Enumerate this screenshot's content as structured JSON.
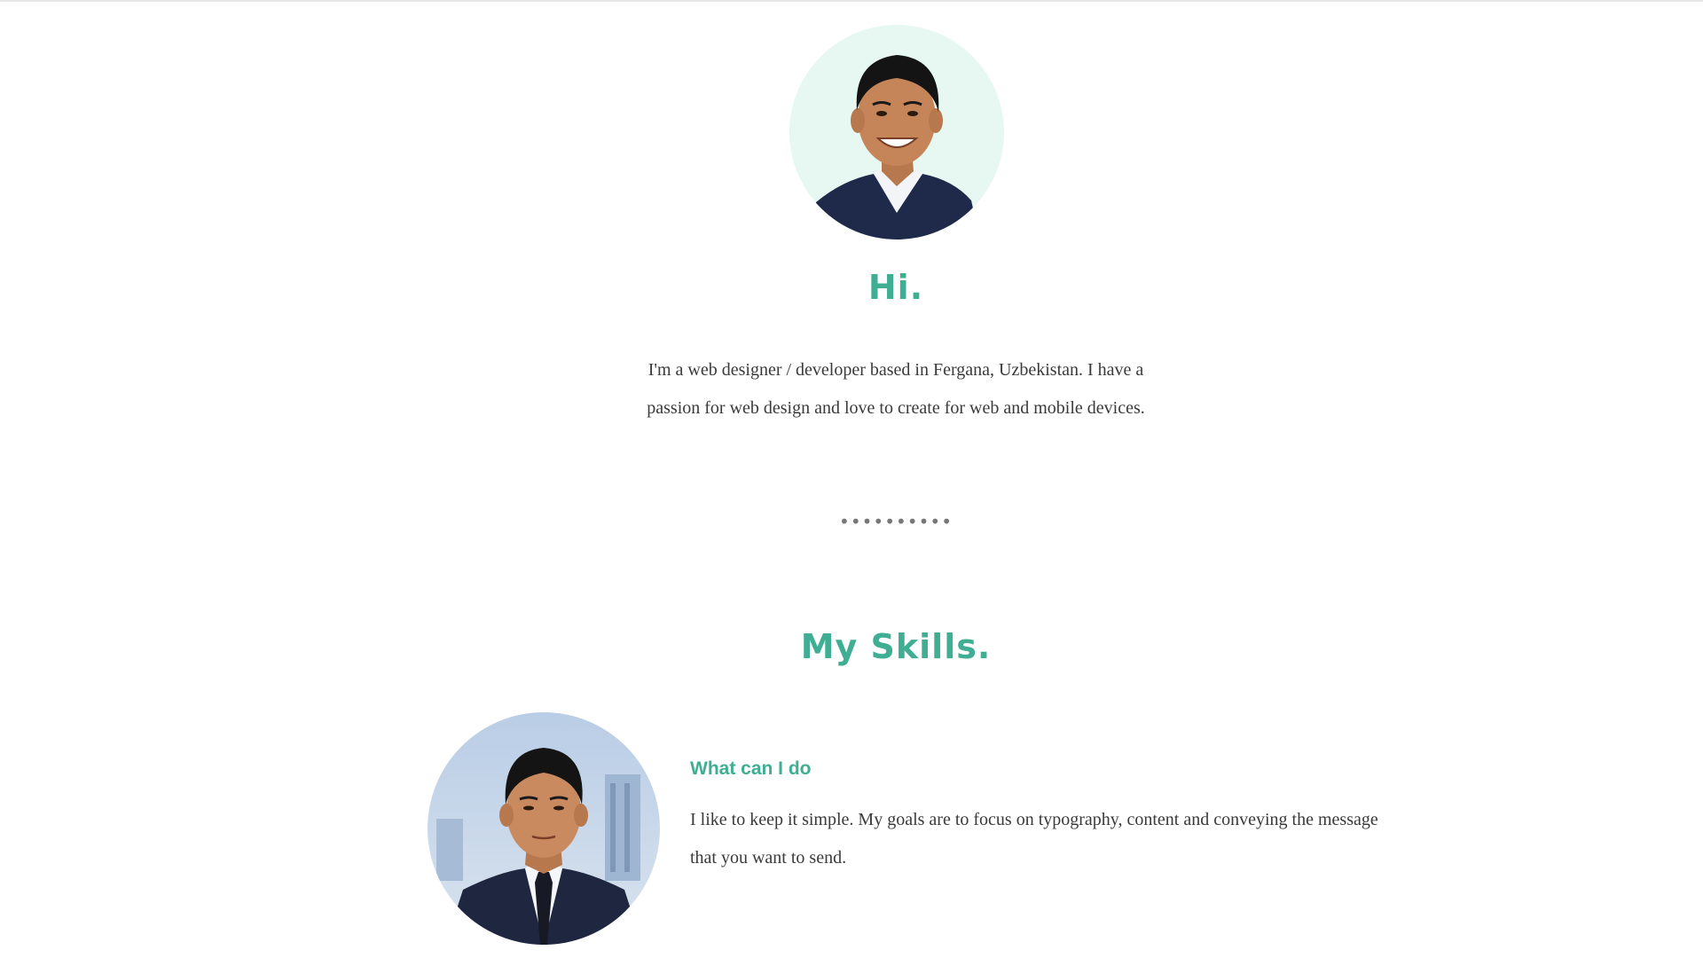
{
  "hero": {
    "avatar_icon": "portrait-smiling",
    "title": "Hi.",
    "intro": "I'm a web designer / developer based in Fergana, Uzbekistan. I have a passion for web design and love to create for web and mobile devices."
  },
  "divider": {
    "text": "••••••••••"
  },
  "skills": {
    "title": "My Skills.",
    "avatar_icon": "portrait-suit-tie",
    "heading": "What can I do",
    "description": "I like to keep it simple. My goals are to focus on typography, content and conveying the message that you want to send."
  },
  "colors": {
    "accent": "#3fae93",
    "body_text": "#3a3a3a",
    "avatar_bg": "#e6f8f1"
  }
}
